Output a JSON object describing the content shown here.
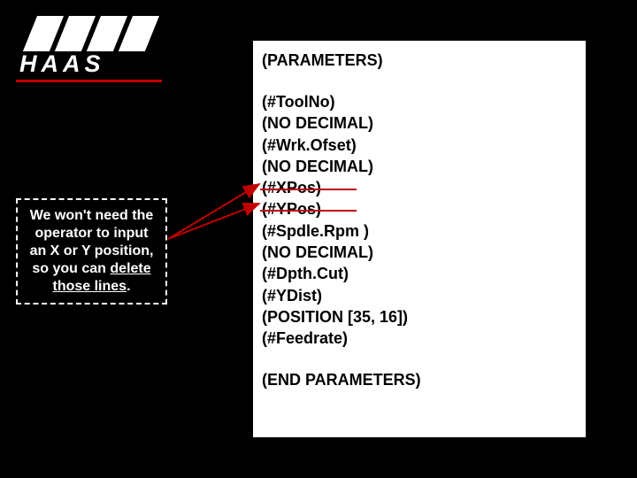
{
  "logo": {
    "name": "HAAS"
  },
  "callout": {
    "l1": "We won't need the",
    "l2": "operator to input",
    "l3": "an X or Y position,",
    "l4_a": "so you can ",
    "l4_u": "delete",
    "l5_u": "those lines",
    "l5_b": "."
  },
  "code": {
    "header": "(PARAMETERS)",
    "lines": [
      {
        "t": "(#ToolNo)",
        "strike": false
      },
      {
        "t": "(NO DECIMAL)",
        "strike": false
      },
      {
        "t": "(#Wrk.Ofset)",
        "strike": false
      },
      {
        "t": "(NO DECIMAL)",
        "strike": false
      },
      {
        "t": "(#XPos)",
        "strike": true
      },
      {
        "t": "(#YPos)",
        "strike": true
      },
      {
        "t": "(#Spdle.Rpm )",
        "strike": false
      },
      {
        "t": "(NO DECIMAL)",
        "strike": false
      },
      {
        "t": "(#Dpth.Cut)",
        "strike": false
      },
      {
        "t": "(#YDist)",
        "strike": false
      },
      {
        "t": "(POSITION [35, 16])",
        "strike": false
      },
      {
        "t": "(#Feedrate)",
        "strike": false
      }
    ],
    "footer": "(END PARAMETERS)"
  }
}
